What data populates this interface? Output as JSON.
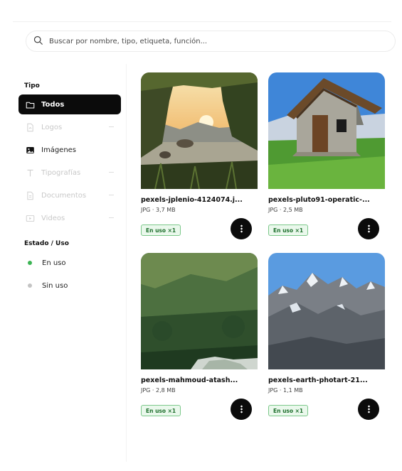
{
  "search": {
    "placeholder": "Buscar por nombre, tipo, etiqueta, función..."
  },
  "sidebar": {
    "type_title": "Tipo",
    "type_items": [
      {
        "label": "Todos",
        "icon": "folder-icon",
        "state": "active"
      },
      {
        "label": "Logos",
        "icon": "file-icon",
        "state": "disabled"
      },
      {
        "label": "Imágenes",
        "icon": "image-icon",
        "state": "normal"
      },
      {
        "label": "Tipografías",
        "icon": "type-icon",
        "state": "disabled"
      },
      {
        "label": "Documentos",
        "icon": "document-icon",
        "state": "disabled"
      },
      {
        "label": "Videos",
        "icon": "video-icon",
        "state": "disabled"
      }
    ],
    "status_title": "Estado / Uso",
    "status_items": [
      {
        "label": "En uso",
        "color": "#3cb454"
      },
      {
        "label": "Sin uso",
        "color": "#c4c4c4"
      }
    ]
  },
  "assets": [
    {
      "name": "pexels-jplenio-4124074.j...",
      "meta": "JPG · 3,7 MB",
      "badge": "En uso ×1",
      "image": "lake-sunset"
    },
    {
      "name": "pexels-pluto91-operatic-...",
      "meta": "JPG · 2,5 MB",
      "badge": "En uso ×1",
      "image": "stone-hut"
    },
    {
      "name": "pexels-mahmoud-atash...",
      "meta": "JPG · 2,8 MB",
      "badge": "En uso ×1",
      "image": "forest-valley"
    },
    {
      "name": "pexels-earth-photart-21...",
      "meta": "JPG · 1,1 MB",
      "badge": "En uso ×1",
      "image": "snowy-mountains"
    }
  ],
  "colors": {
    "accent": "#0b0b0b",
    "badge_border": "#7cc88a",
    "badge_bg": "#eaf8ec"
  }
}
